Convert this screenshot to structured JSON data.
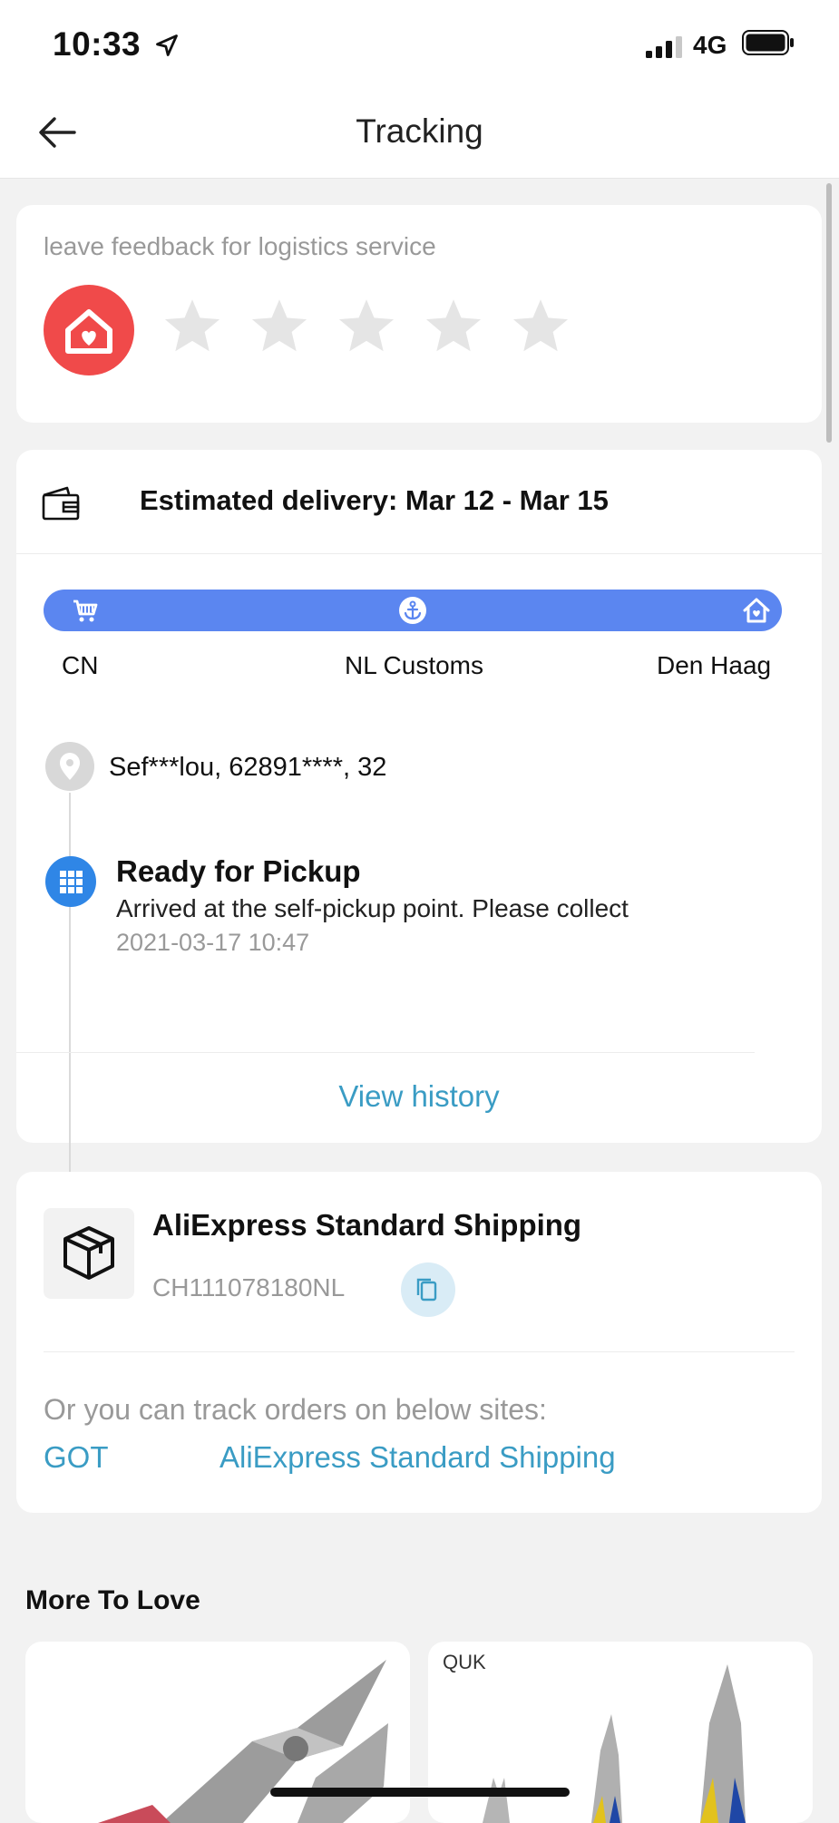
{
  "status_bar": {
    "time": "10:33",
    "network": "4G"
  },
  "nav": {
    "title": "Tracking"
  },
  "feedback": {
    "prompt": "leave feedback for logistics service",
    "rating": 0,
    "max_rating": 5
  },
  "delivery": {
    "estimated": "Estimated delivery: Mar 12 - Mar 15",
    "stops": [
      "CN",
      "NL Customs",
      "Den Haag"
    ],
    "address": "Sef***lou,  62891****,  32",
    "event": {
      "title": "Ready for Pickup",
      "description": "Arrived at the self-pickup point. Please collect",
      "time": "2021-03-17 10:47"
    },
    "view_history": "View history"
  },
  "shipping": {
    "service": "AliExpress Standard Shipping",
    "tracking_number": "CH111078180NL",
    "alt_prompt": "Or you can track orders on below sites:",
    "sites": [
      "GOT",
      "AliExpress Standard Shipping"
    ]
  },
  "more": {
    "title": "More To Love",
    "products": [
      {
        "brand": ""
      },
      {
        "brand": "QUK"
      }
    ]
  },
  "colors": {
    "accent_blue": "#5b86f0",
    "link": "#3a9cc4",
    "feedback_red": "#f04a4a",
    "event_blue": "#2f86e6"
  }
}
